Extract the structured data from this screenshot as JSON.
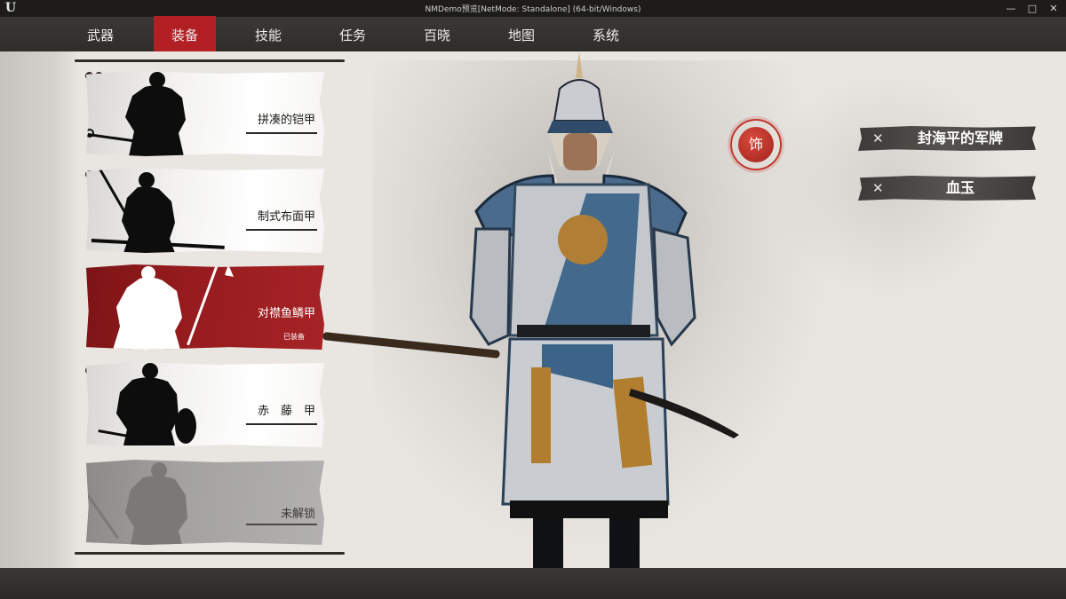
{
  "window": {
    "title": "NMDemo预览[NetMode: Standalone]  (64-bit/Windows)",
    "logo": "U",
    "controls": [
      "—",
      "□",
      "✕"
    ]
  },
  "nav": {
    "tabs": [
      {
        "label": "武器"
      },
      {
        "label": "装备",
        "active": true
      },
      {
        "label": "技能"
      },
      {
        "label": "任务"
      },
      {
        "label": "百晓"
      },
      {
        "label": "地图"
      },
      {
        "label": "系统"
      }
    ]
  },
  "armor_list": {
    "items": [
      {
        "name": "拼凑的铠甲",
        "state": "available",
        "slot_icons": "red-dots"
      },
      {
        "name": "制式布面甲",
        "state": "available",
        "slot_icons": "red-dots"
      },
      {
        "name": "对襟鱼鳞甲",
        "state": "equipped",
        "status": "已装备",
        "slot_icons": "dark-dots"
      },
      {
        "name": "赤　藤　甲",
        "state": "available",
        "slot_icons": "red-dots"
      },
      {
        "name": "未解锁",
        "state": "locked",
        "slot_icons": "empty-dots"
      }
    ]
  },
  "accessory": {
    "badge_label": "饰",
    "slots": [
      {
        "remove_icon": "✕",
        "name": "封海平的军牌"
      },
      {
        "remove_icon": "✕",
        "name": "血玉"
      }
    ]
  },
  "colors": {
    "accent_red": "#b32024",
    "equipped_card": "#951b1e",
    "badge_red": "#c1362d",
    "panel_bg": "#e9e6e2",
    "bar_dark": "#34312e"
  }
}
